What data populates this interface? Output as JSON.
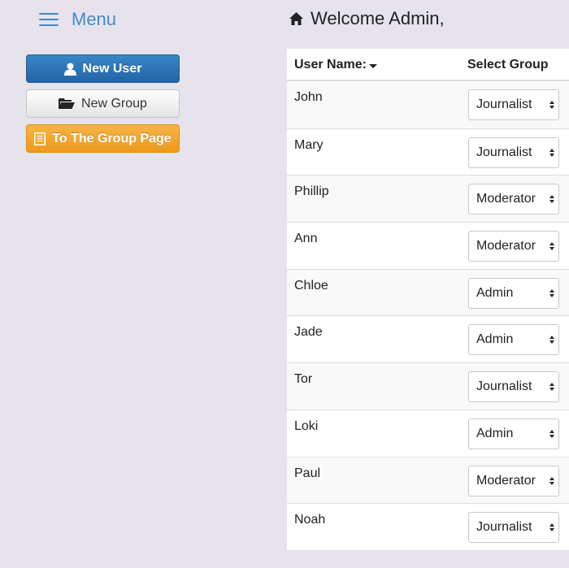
{
  "menu": {
    "label": "Menu"
  },
  "sidebar": {
    "buttons": [
      {
        "label": "New User",
        "icon": "user-icon",
        "style": "primary"
      },
      {
        "label": "New Group",
        "icon": "folder-open-icon",
        "style": "default"
      },
      {
        "label": "To The Group Page",
        "icon": "list-icon",
        "style": "warning"
      }
    ]
  },
  "header": {
    "welcome": "Welcome Admin,",
    "icon": "home-icon"
  },
  "table": {
    "columns": [
      "User Name:",
      "Select Group"
    ],
    "sort_indicator": "caret-down",
    "rows": [
      {
        "name": "John",
        "group": "Journalist"
      },
      {
        "name": "Mary",
        "group": "Journalist"
      },
      {
        "name": "Phillip",
        "group": "Moderator"
      },
      {
        "name": "Ann",
        "group": "Moderator"
      },
      {
        "name": "Chloe",
        "group": "Admin"
      },
      {
        "name": "Jade",
        "group": "Admin"
      },
      {
        "name": "Tor",
        "group": "Journalist"
      },
      {
        "name": "Loki",
        "group": "Admin"
      },
      {
        "name": "Paul",
        "group": "Moderator"
      },
      {
        "name": "Noah",
        "group": "Journalist"
      }
    ]
  },
  "colors": {
    "background": "#e6e3ec",
    "menu_accent": "#428bca",
    "primary": "#2a6fb0",
    "warning": "#f0a02a"
  }
}
